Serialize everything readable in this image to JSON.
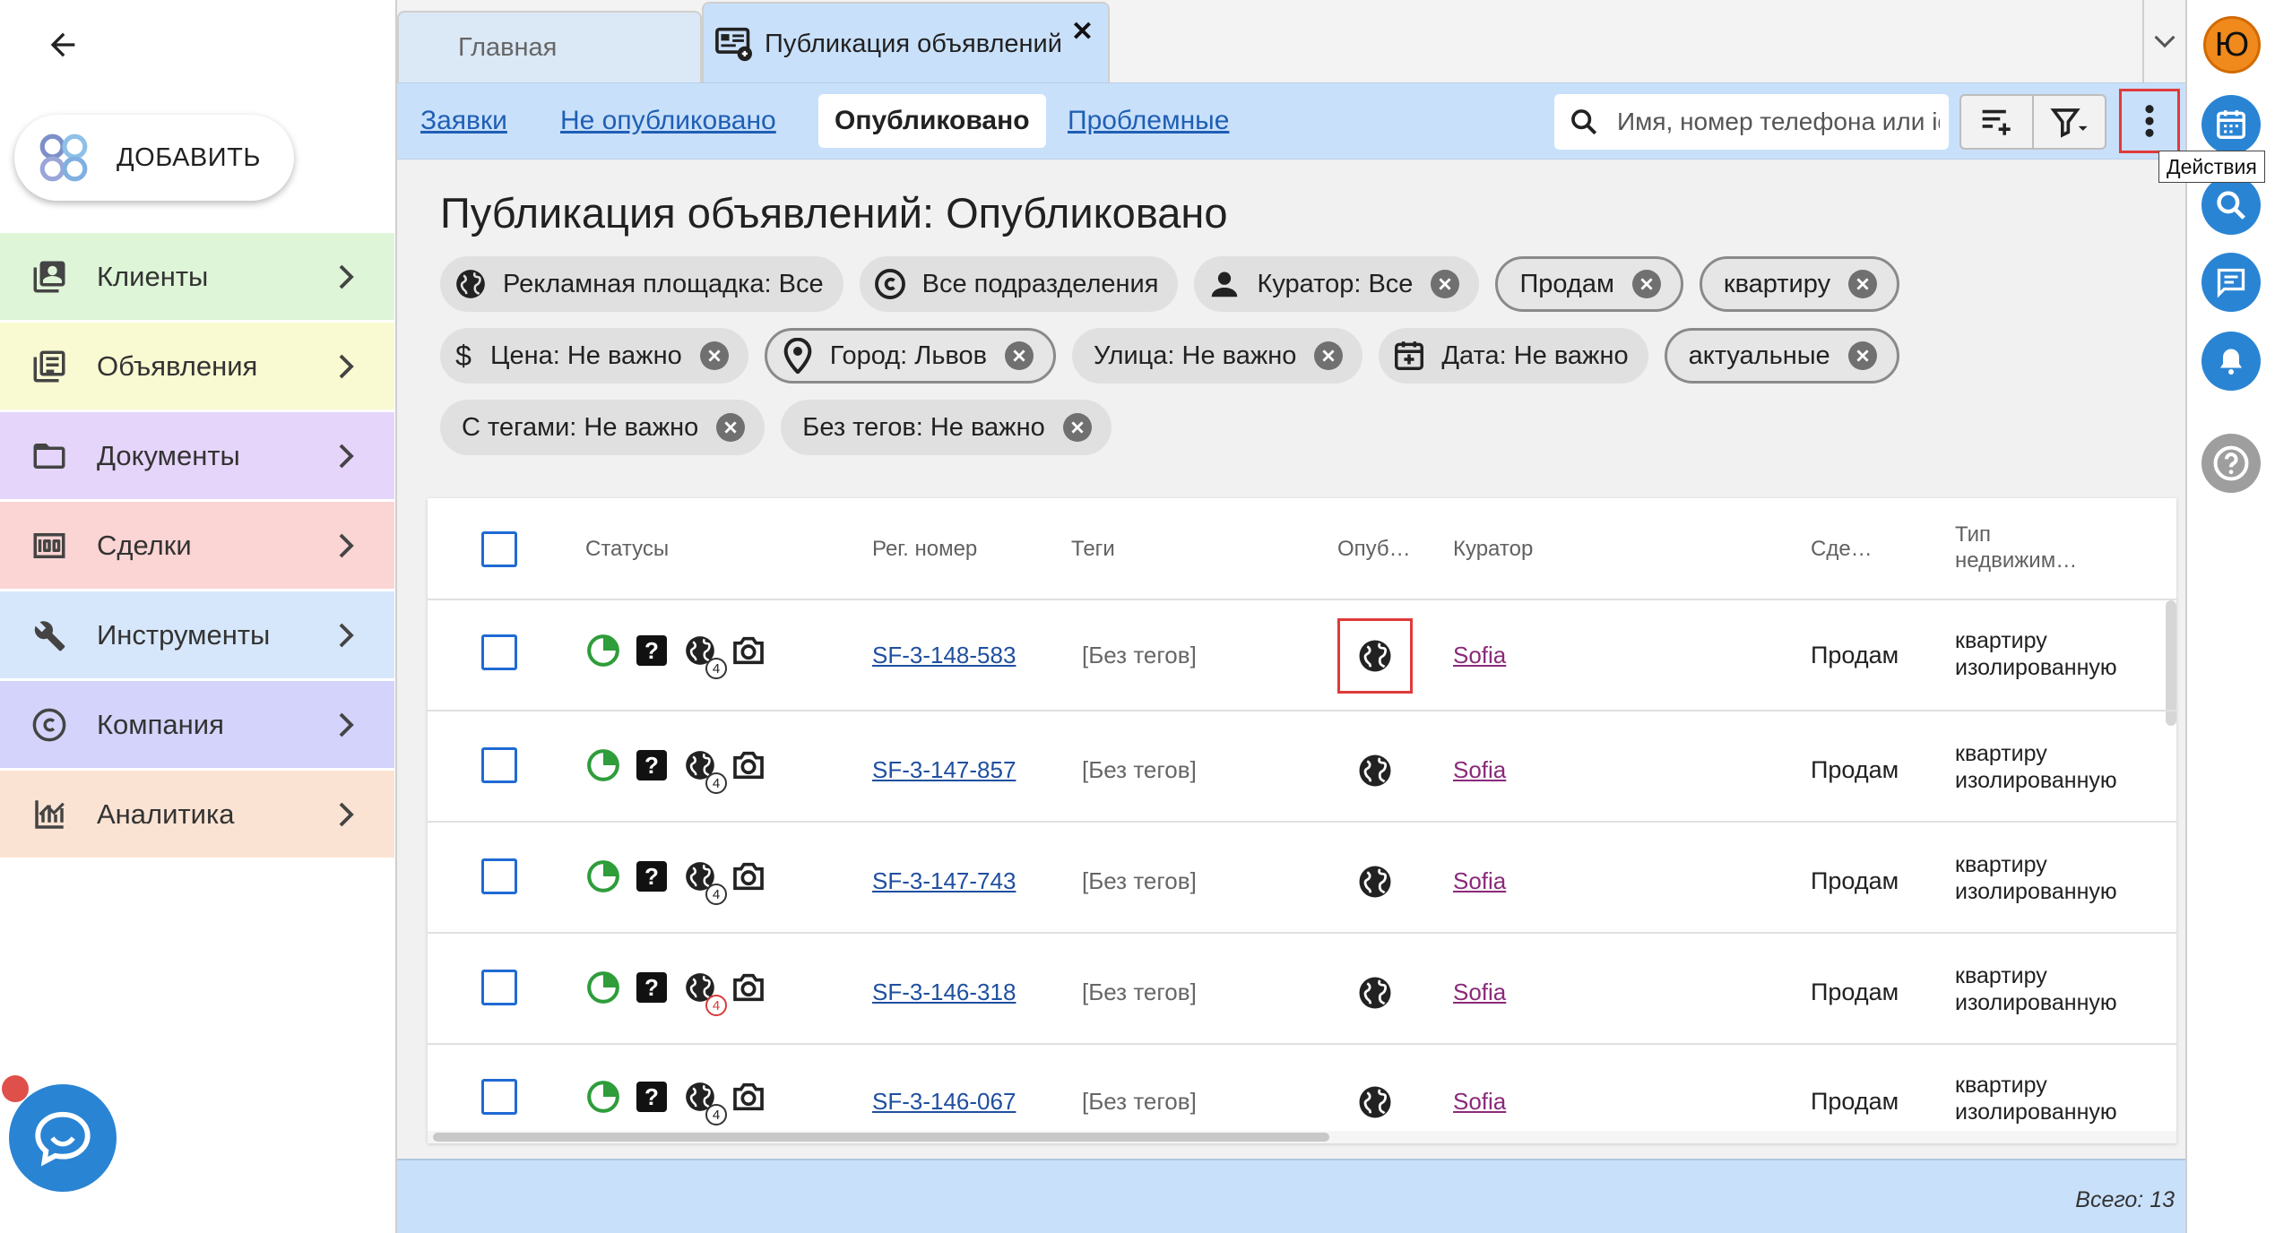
{
  "sidebar": {
    "add_label": "ДОБАВИТЬ",
    "items": [
      {
        "label": "Клиенты",
        "bg": "#dff5d8",
        "icon": "contacts-icon"
      },
      {
        "label": "Объявления",
        "bg": "#fafad2",
        "icon": "listing-icon"
      },
      {
        "label": "Документы",
        "bg": "#e6d5fb",
        "icon": "folder-icon"
      },
      {
        "label": "Сделки",
        "bg": "#fbd4d4",
        "icon": "money-icon"
      },
      {
        "label": "Инструменты",
        "bg": "#d7e7fb",
        "icon": "tools-icon"
      },
      {
        "label": "Компания",
        "bg": "#d3d3fb",
        "icon": "copyright-icon"
      },
      {
        "label": "Аналитика",
        "bg": "#fbe3d3",
        "icon": "analytics-icon"
      }
    ]
  },
  "tabs": {
    "home": "Главная",
    "publication": "Публикация объявлений"
  },
  "subtabs": {
    "requests": "Заявки",
    "unpublished": "Не опубликовано",
    "published": "Опубликовано",
    "problematic": "Проблемные"
  },
  "search": {
    "placeholder": "Имя, номер телефона или id"
  },
  "page_title": "Публикация объявлений: Опубликовано",
  "chips": {
    "row1": [
      "Рекламная площадка: Все",
      "Все подразделения",
      "Куратор: Все",
      "Продам",
      "квартиру"
    ],
    "row2": [
      "Цена: Не важно",
      "Город: Львов",
      "Улица: Не важно",
      "Дата: Не важно",
      "актуальные"
    ],
    "row3": [
      "С тегами: Не важно",
      "Без тегов: Не важно"
    ]
  },
  "table": {
    "headers": {
      "statuses": "Статусы",
      "reg": "Рег. номер",
      "tags": "Теги",
      "pub": "Опуб…",
      "curator": "Куратор",
      "deal": "Сде…",
      "type1": "Тип",
      "type2": "недвижим…"
    },
    "rows": [
      {
        "reg": "SF-3-148-583",
        "tags": "[Без тегов]",
        "curator": "Sofia",
        "deal": "Продам",
        "type1": "квартиру",
        "type2": "изолированную",
        "badge": "4"
      },
      {
        "reg": "SF-3-147-857",
        "tags": "[Без тегов]",
        "curator": "Sofia",
        "deal": "Продам",
        "type1": "квартиру",
        "type2": "изолированную",
        "badge": "4"
      },
      {
        "reg": "SF-3-147-743",
        "tags": "[Без тегов]",
        "curator": "Sofia",
        "deal": "Продам",
        "type1": "квартиру",
        "type2": "изолированную",
        "badge": "4"
      },
      {
        "reg": "SF-3-146-318",
        "tags": "[Без тегов]",
        "curator": "Sofia",
        "deal": "Продам",
        "type1": "квартиру",
        "type2": "изолированную",
        "badge": "4"
      },
      {
        "reg": "SF-3-146-067",
        "tags": "[Без тегов]",
        "curator": "Sofia",
        "deal": "Продам",
        "type1": "квартиру",
        "type2": "изолированную",
        "badge": "4"
      }
    ]
  },
  "footer": {
    "total": "Всего: 13"
  },
  "rail": {
    "avatar": "Ю",
    "tooltip": "Действия"
  },
  "colors": {
    "accent": "#2a84d4",
    "highlight": "#e03a3a",
    "bar": "#c9e0fa"
  }
}
